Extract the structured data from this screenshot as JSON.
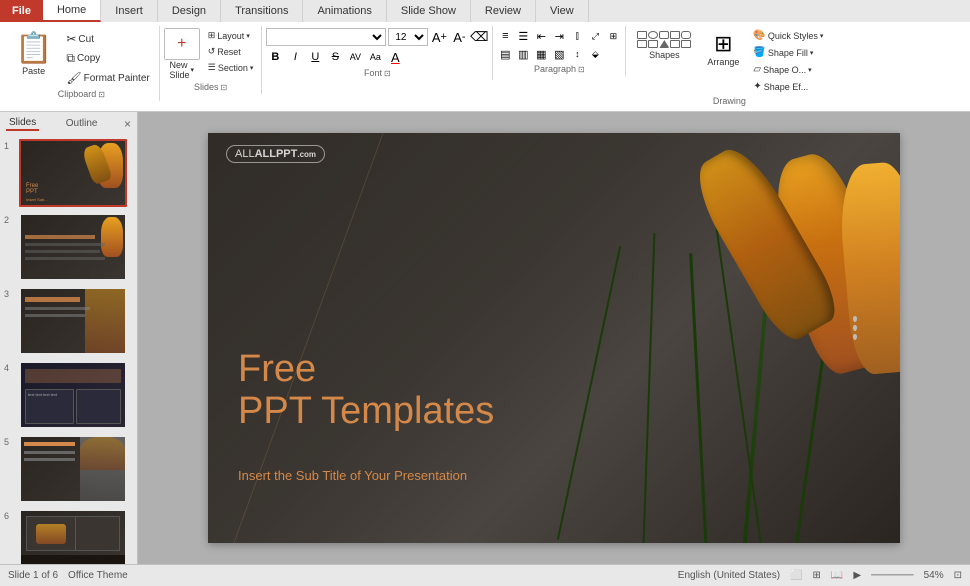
{
  "titlebar": {
    "file_label": "File",
    "tabs": [
      "Home",
      "Insert",
      "Design",
      "Transitions",
      "Animations",
      "Slide Show",
      "Review",
      "View"
    ]
  },
  "ribbon": {
    "clipboard": {
      "label": "Clipboard",
      "paste_label": "Paste",
      "cut_label": "Cut",
      "copy_label": "Copy",
      "format_painter_label": "Format Painter"
    },
    "slides": {
      "label": "Slides",
      "new_slide_label": "New\nSlide",
      "layout_label": "Layout",
      "reset_label": "Reset",
      "section_label": "Section"
    },
    "font": {
      "label": "Font",
      "font_name": "",
      "font_size": "12",
      "bold": "B",
      "italic": "I",
      "underline": "U",
      "strikethrough": "S",
      "char_spacing": "AV",
      "change_case": "Aa",
      "font_color": "A"
    },
    "paragraph": {
      "label": "Paragraph"
    },
    "drawing": {
      "label": "Drawing",
      "shapes_label": "Shapes",
      "arrange_label": "Arrange",
      "quick_styles_label": "Quick\nStyles",
      "shape_fill_label": "Shape Fill",
      "shape_outline_label": "Shape O...",
      "shape_effects_label": "Shape Ef..."
    }
  },
  "slide_panel": {
    "slides_tab": "Slides",
    "outline_tab": "Outline",
    "close_label": "×",
    "slides": [
      {
        "number": "1",
        "selected": true
      },
      {
        "number": "2",
        "selected": false
      },
      {
        "number": "3",
        "selected": false
      },
      {
        "number": "4",
        "selected": false
      },
      {
        "number": "5",
        "selected": false
      },
      {
        "number": "6",
        "selected": false
      }
    ]
  },
  "slide": {
    "logo": "ALLPPT",
    "logo_suffix": ".com",
    "title_line1": "Free",
    "title_line2": "PPT Templates",
    "subtitle": "Insert the Sub Title of Your Presentation"
  },
  "statusbar": {
    "slide_info": "Slide 1 of 6",
    "theme": "Office Theme",
    "language": "English (United States)"
  }
}
